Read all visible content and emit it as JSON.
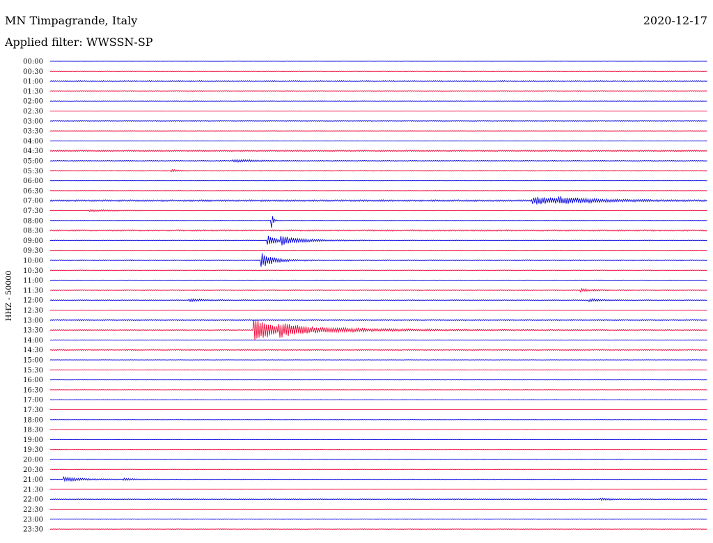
{
  "header": {
    "station": "MN Timpagrande, Italy",
    "date": "2020-12-17",
    "filter_label": "Applied filter:",
    "filter_value": "WWSSN-SP"
  },
  "colors": {
    "blue": "#0000dd",
    "red": "#ee0033"
  },
  "chart_data": {
    "type": "line",
    "title": "MN Timpagrande, Italy",
    "ylabel": "HHZ - 50000",
    "categories": [
      "00:00",
      "00:30",
      "01:00",
      "01:30",
      "02:00",
      "02:30",
      "03:00",
      "03:30",
      "04:00",
      "04:30",
      "05:00",
      "05:30",
      "06:00",
      "06:30",
      "07:00",
      "07:30",
      "08:00",
      "08:30",
      "09:00",
      "09:30",
      "10:00",
      "10:30",
      "11:00",
      "11:30",
      "12:00",
      "12:30",
      "13:00",
      "13:30",
      "14:00",
      "14:30",
      "15:00",
      "15:30",
      "16:00",
      "16:30",
      "17:00",
      "17:30",
      "18:00",
      "18:30",
      "19:00",
      "19:30",
      "20:00",
      "20:30",
      "21:00",
      "21:30",
      "22:00",
      "22:30",
      "23:00",
      "23:30"
    ],
    "trace_minutes": 30,
    "trace_colors": [
      "blue",
      "red"
    ],
    "noise": [
      0.2,
      0.2,
      0.9,
      0.5,
      0.3,
      0.3,
      0.6,
      0.3,
      0.3,
      1.0,
      0.7,
      0.6,
      0.3,
      0.3,
      1.2,
      0.4,
      0.3,
      1.0,
      0.5,
      0.4,
      0.8,
      0.4,
      0.4,
      0.7,
      0.5,
      0.3,
      0.8,
      0.6,
      0.3,
      0.9,
      0.3,
      0.3,
      0.3,
      0.3,
      0.3,
      0.3,
      0.3,
      0.3,
      0.3,
      0.3,
      0.6,
      0.3,
      0.4,
      0.3,
      0.6,
      0.3,
      0.3,
      0.4
    ],
    "events": [
      {
        "trace": "05:00",
        "minute": 8.3,
        "amp": 2,
        "dur": 0.8
      },
      {
        "trace": "05:30",
        "minute": 5.5,
        "amp": 2,
        "dur": 0.3
      },
      {
        "trace": "07:00",
        "minute": 22.0,
        "amp": 5,
        "dur": 2.0
      },
      {
        "trace": "07:00",
        "minute": 23.2,
        "amp": 3,
        "dur": 1.0
      },
      {
        "trace": "07:30",
        "minute": 1.8,
        "amp": 1.5,
        "dur": 1.0
      },
      {
        "trace": "08:00",
        "minute": 10.1,
        "amp": 14,
        "dur": 0.08
      },
      {
        "trace": "09:00",
        "minute": 9.9,
        "amp": 8,
        "dur": 0.4
      },
      {
        "trace": "09:00",
        "minute": 10.5,
        "amp": 6,
        "dur": 1.0
      },
      {
        "trace": "10:00",
        "minute": 9.6,
        "amp": 12,
        "dur": 0.5
      },
      {
        "trace": "11:30",
        "minute": 24.2,
        "amp": 2,
        "dur": 0.5
      },
      {
        "trace": "12:00",
        "minute": 6.3,
        "amp": 2,
        "dur": 0.8
      },
      {
        "trace": "12:00",
        "minute": 24.6,
        "amp": 2,
        "dur": 0.6
      },
      {
        "trace": "13:30",
        "minute": 9.3,
        "amp": 22,
        "dur": 0.8
      },
      {
        "trace": "13:30",
        "minute": 10.4,
        "amp": 6,
        "dur": 3.5
      },
      {
        "trace": "21:00",
        "minute": 0.6,
        "amp": 3,
        "dur": 1.0
      },
      {
        "trace": "21:00",
        "minute": 3.3,
        "amp": 1.5,
        "dur": 0.5
      },
      {
        "trace": "22:00",
        "minute": 25.1,
        "amp": 2,
        "dur": 0.4
      }
    ]
  }
}
